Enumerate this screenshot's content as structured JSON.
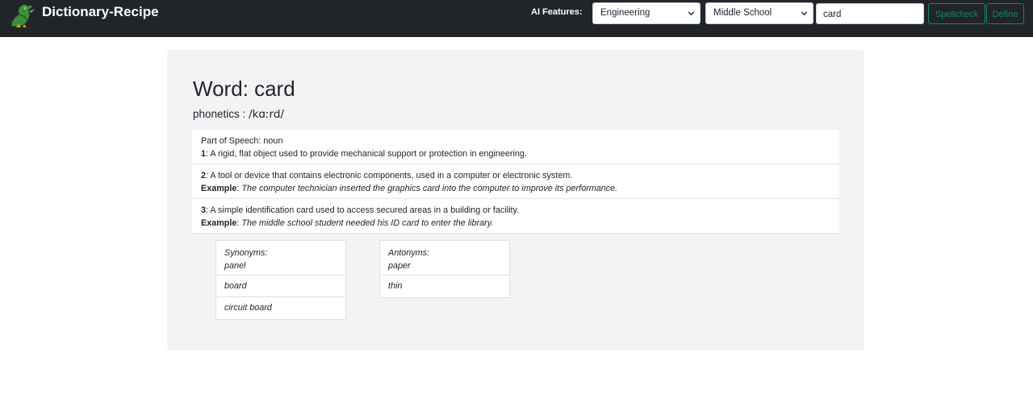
{
  "navbar": {
    "brand": "Dictionary-Recipe",
    "logo_icon": "dragon-icon",
    "ai_label": "AI Features:",
    "field_select": "Engineering",
    "level_select": "Middle School",
    "search_value": "card",
    "spellcheck_label": "Spellcheck",
    "define_label": "Define",
    "accent_color": "#198754",
    "bar_color": "#212529"
  },
  "entry": {
    "title": "Word: card",
    "phonetics_label": "phonetics :",
    "phonetics_value": "/kɑːrd/",
    "part_of_speech": "Part of Speech: noun",
    "definitions": [
      {
        "num": "1",
        "text": ": A rigid, flat object used to provide mechanical support or protection in engineering.",
        "example": ""
      },
      {
        "num": "2",
        "text": ": A tool or device that contains electronic components, used in a computer or electronic system.",
        "example_label": "Example",
        "example": "The computer technician inserted the graphics card into the computer to improve its performance."
      },
      {
        "num": "3",
        "text": ": A simple identification card used to access secured areas in a building or facility.",
        "example_label": "Example",
        "example": "The middle school student needed his ID card to enter the library."
      }
    ],
    "synonyms_label": "Synonyms:",
    "synonyms": [
      "panel",
      "board",
      "circuit board"
    ],
    "antonyms_label": "Antonyms:",
    "antonyms": [
      "paper",
      "thin"
    ]
  }
}
